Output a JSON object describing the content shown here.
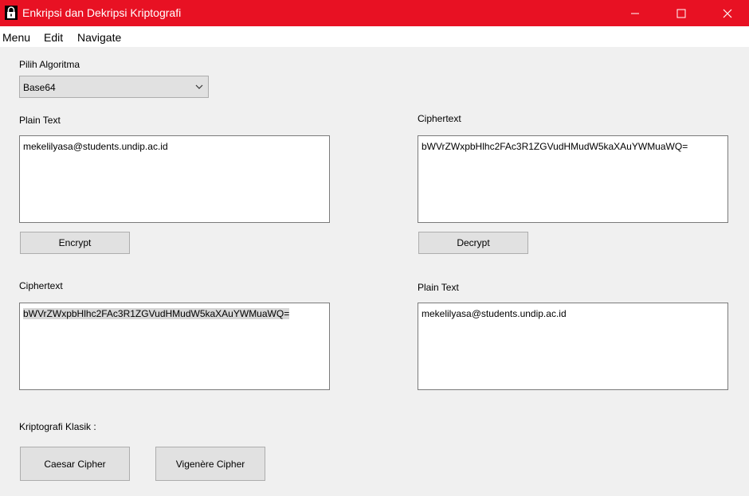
{
  "window": {
    "title": "Enkripsi dan Dekripsi Kriptografi",
    "icon": "lock-icon",
    "title_bar_color": "#e81123",
    "controls": [
      "minimize-icon",
      "maximize-icon",
      "close-icon"
    ]
  },
  "menubar": {
    "items": [
      "Menu",
      "Edit",
      "Navigate"
    ]
  },
  "algorithm": {
    "label": "Pilih Algoritma",
    "selected": "Base64"
  },
  "encrypt_section": {
    "plain_label": "Plain Text",
    "plain_value": "mekelilyasa@students.undip.ac.id",
    "button": "Encrypt",
    "cipher_label": "Ciphertext",
    "cipher_value": "bWVrZWxpbHlhc2FAc3R1ZGVudHMudW5kaXAuYWMuaWQ="
  },
  "decrypt_section": {
    "cipher_label": "Ciphertext",
    "cipher_value": "bWVrZWxpbHlhc2FAc3R1ZGVudHMudW5kaXAuYWMuaWQ=",
    "button": "Decrypt",
    "plain_label": "Plain Text",
    "plain_value": "mekelilyasa@students.undip.ac.id"
  },
  "classic": {
    "label": "Kriptografi Klasik :",
    "buttons": [
      "Caesar Cipher",
      "Vigenère Cipher"
    ]
  }
}
